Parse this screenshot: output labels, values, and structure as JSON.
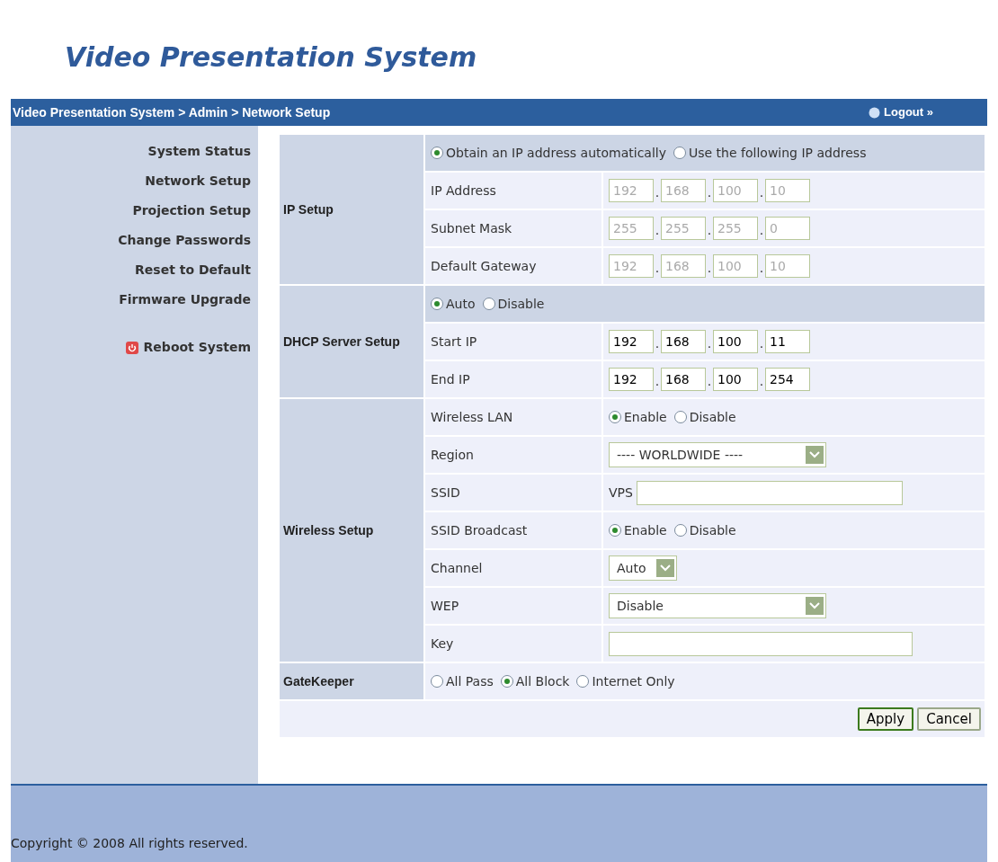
{
  "logo": "Video Presentation System",
  "breadcrumb": "Video Presentation System > Admin > Network Setup",
  "logout": "Logout »",
  "sidebar": {
    "items": [
      {
        "label": "System Status"
      },
      {
        "label": "Network Setup"
      },
      {
        "label": "Projection Setup"
      },
      {
        "label": "Change Passwords"
      },
      {
        "label": "Reset to Default"
      },
      {
        "label": "Firmware Upgrade"
      }
    ],
    "reboot": "Reboot System"
  },
  "sections": [
    {
      "title": "IP Setup",
      "rows": [
        {
          "kind": "choice",
          "options": [
            {
              "label": "Obtain an IP address automatically",
              "selected": true
            },
            {
              "label": "Use the following IP address",
              "selected": false
            }
          ]
        },
        {
          "kind": "ip",
          "label": "IP Address",
          "disabled": true,
          "octets": [
            "192",
            "168",
            "100",
            "10"
          ],
          "separators": [
            ".",
            ".",
            "."
          ]
        },
        {
          "kind": "ip",
          "label": "Subnet Mask",
          "disabled": true,
          "octets": [
            "255",
            "255",
            "255",
            "0"
          ],
          "separators": [
            ".",
            ".",
            "."
          ]
        },
        {
          "kind": "ip",
          "label": "Default Gateway",
          "disabled": true,
          "octets": [
            "192",
            "168",
            "100",
            "10"
          ],
          "separators": [
            ".",
            ".",
            "."
          ]
        }
      ]
    },
    {
      "title": "DHCP Server Setup",
      "rows": [
        {
          "kind": "choice",
          "options": [
            {
              "label": "Auto",
              "selected": true
            },
            {
              "label": "Disable",
              "selected": false
            }
          ]
        },
        {
          "kind": "ip",
          "label": "Start IP",
          "disabled": false,
          "octets": [
            "192",
            "168",
            "100",
            "11"
          ],
          "separators": [
            ".",
            ".",
            "."
          ]
        },
        {
          "kind": "ip",
          "label": "End IP",
          "disabled": false,
          "octets": [
            "192",
            "168",
            "100",
            "254"
          ],
          "separators": [
            ".",
            ".",
            "."
          ]
        }
      ]
    },
    {
      "title": "Wireless Setup",
      "rows": [
        {
          "kind": "choice",
          "label": "Wireless LAN",
          "options": [
            {
              "label": "Enable",
              "selected": true
            },
            {
              "label": "Disable",
              "selected": false
            }
          ]
        },
        {
          "kind": "select",
          "label": "Region",
          "value": "---- WORLDWIDE ----"
        },
        {
          "kind": "text",
          "label": "SSID",
          "prefix": "VPS"
        },
        {
          "kind": "choice",
          "label": "SSID Broadcast",
          "options": [
            {
              "label": "Enable",
              "selected": true
            },
            {
              "label": "Disable",
              "selected": false
            }
          ]
        },
        {
          "kind": "compact_select",
          "label": "Channel",
          "value": "Auto"
        },
        {
          "kind": "select",
          "label": "WEP",
          "value": "Disable"
        },
        {
          "kind": "text",
          "label": "Key"
        }
      ]
    },
    {
      "title": "GateKeeper",
      "rows": [
        {
          "kind": "choice",
          "options": [
            {
              "label": "All Pass",
              "selected": false
            },
            {
              "label": "All Block",
              "selected": true
            },
            {
              "label": "Internet Only",
              "selected": false
            }
          ]
        }
      ]
    }
  ],
  "buttons": [
    {
      "label": "Apply",
      "primary": true
    },
    {
      "label": "Cancel",
      "primary": false
    }
  ],
  "footer": "Copyright © 2008 All rights reserved."
}
